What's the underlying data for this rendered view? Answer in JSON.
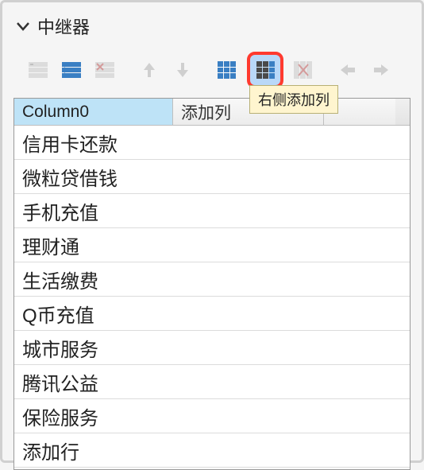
{
  "header": {
    "title": "中继器"
  },
  "toolbar": {
    "tooltip": "右侧添加列"
  },
  "table": {
    "column0": "Column0",
    "addColumn": "添加列",
    "rows": [
      "信用卡还款",
      "微粒贷借钱",
      "手机充值",
      "理财通",
      "生活缴费",
      "Q币充值",
      "城市服务",
      "腾讯公益",
      "保险服务",
      "添加行"
    ]
  }
}
